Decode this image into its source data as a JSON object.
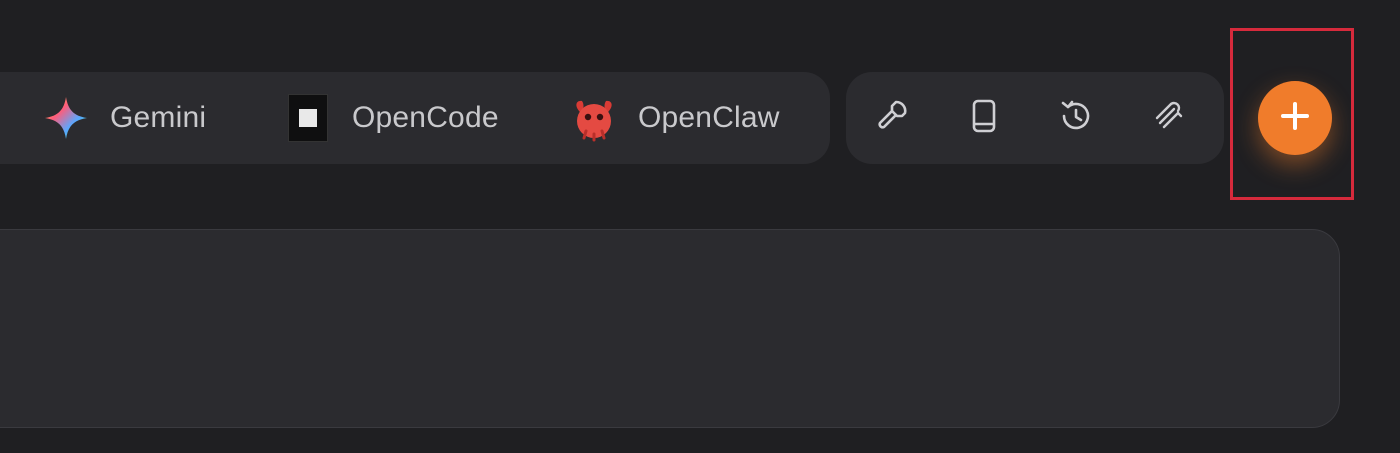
{
  "provider_tabs": [
    {
      "label": "Gemini",
      "icon": "gemini-icon"
    },
    {
      "label": "OpenCode",
      "icon": "opencode-icon"
    },
    {
      "label": "OpenClaw",
      "icon": "openclaw-icon"
    }
  ],
  "tools": [
    {
      "icon": "wrench-icon"
    },
    {
      "icon": "book-icon"
    },
    {
      "icon": "history-icon"
    },
    {
      "icon": "sparkle-icon"
    }
  ],
  "add_button": {
    "icon": "plus-icon"
  },
  "colors": {
    "background": "#1f1f22",
    "surface": "#2b2b2f",
    "text": "#c9c9cc",
    "accent": "#f07c2b",
    "highlight": "#d62a3c"
  }
}
